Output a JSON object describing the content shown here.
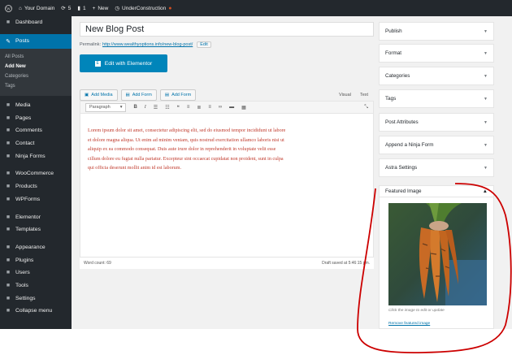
{
  "adminbar": {
    "site_name": "Your Domain",
    "updates_count": "5",
    "comments_count": "1",
    "new_label": "New",
    "plugin_label": "UnderConstruction"
  },
  "sidebar": {
    "items_top": [
      {
        "label": "Dashboard",
        "icon": "dashboard-icon"
      }
    ],
    "posts": {
      "label": "Posts",
      "icon": "pushpin-icon"
    },
    "posts_submenu": [
      {
        "label": "All Posts"
      },
      {
        "label": "Add New"
      },
      {
        "label": "Categories"
      },
      {
        "label": "Tags"
      }
    ],
    "items_main": [
      {
        "label": "Media",
        "icon": "media-icon"
      },
      {
        "label": "Pages",
        "icon": "pages-icon"
      },
      {
        "label": "Comments",
        "icon": "comments-icon"
      },
      {
        "label": "Contact",
        "icon": "mail-icon"
      },
      {
        "label": "Ninja Forms",
        "icon": "forms-icon"
      }
    ],
    "items_commerce": [
      {
        "label": "WooCommerce",
        "icon": "woocommerce-icon"
      },
      {
        "label": "Products",
        "icon": "products-icon"
      },
      {
        "label": "WPForms",
        "icon": "wpforms-icon"
      }
    ],
    "items_builder": [
      {
        "label": "Elementor",
        "icon": "elementor-icon"
      },
      {
        "label": "Templates",
        "icon": "folder-icon"
      }
    ],
    "items_bottom": [
      {
        "label": "Appearance",
        "icon": "brush-icon"
      },
      {
        "label": "Plugins",
        "icon": "plugin-icon"
      },
      {
        "label": "Users",
        "icon": "user-icon"
      },
      {
        "label": "Tools",
        "icon": "wrench-icon"
      },
      {
        "label": "Settings",
        "icon": "settings-icon"
      },
      {
        "label": "Collapse menu",
        "icon": "collapse-icon"
      }
    ]
  },
  "editor": {
    "title": "New Blog Post",
    "permalink_label": "Permalink:",
    "permalink_url": "http://www.wealthyoptions.info/new-blog-post/",
    "permalink_edit": "Edit",
    "elementor_button": "Edit with Elementor",
    "media_buttons": [
      "Add Media",
      "Add Form",
      "Add Form"
    ],
    "tab_visual": "Visual",
    "tab_text": "Text",
    "format_select": "Paragraph",
    "content_lines": [
      "Lorem ipsum dolor sit amet, consectetur adipiscing elit, sed do eiusmod tempor incididunt ut labore",
      "et dolore magna aliqua. Ut enim ad minim veniam, quis nostrud exercitation ullamco laboris nisi ut",
      "aliquip ex ea commodo consequat. Duis aute irure dolor in reprehenderit in voluptate velit esse",
      "cillum dolore eu fugiat nulla pariatur. Excepteur sint occaecat cupidatat non proident, sunt in culpa",
      "qui officia deserunt mollit anim id est laborum."
    ],
    "word_count": "Word count: 69",
    "draft_saved": "Draft saved at 5:46:15 pm."
  },
  "right_panels": [
    "Publish",
    "Format",
    "Categories",
    "Tags",
    "Post Attributes",
    "Append a Ninja Form",
    "Astra Settings"
  ],
  "featured_image": {
    "title": "Featured Image",
    "help_text": "Click the image to edit or update",
    "remove_link": "Remove featured image"
  },
  "colors": {
    "admin_bar": "#23282d",
    "active_menu": "#0073aa",
    "elementor_button": "#0085ba",
    "annotation_circle": "#cc0000"
  }
}
